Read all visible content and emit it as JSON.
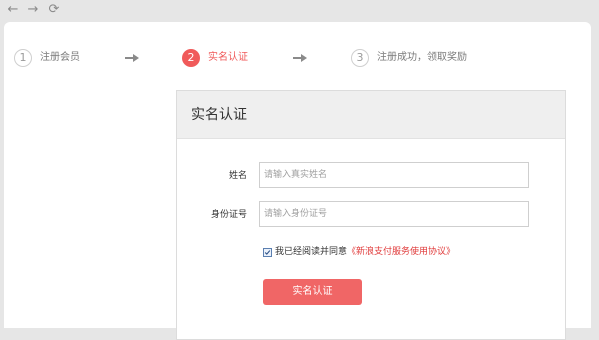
{
  "browser": {
    "back_icon": "arrow-left-icon",
    "forward_icon": "arrow-right-icon",
    "refresh_icon": "refresh-icon"
  },
  "steps": [
    {
      "number": "1",
      "label": "注册会员",
      "state": "inactive"
    },
    {
      "number": "2",
      "label": "实名认证",
      "state": "active"
    },
    {
      "number": "3",
      "label": "注册成功，领取奖励",
      "state": "inactive"
    }
  ],
  "card": {
    "title": "实名认证",
    "name_label": "姓名",
    "name_placeholder": "请输入真实姓名",
    "name_value": "",
    "id_label": "身份证号",
    "id_placeholder": "请输入身份证号",
    "id_value": "",
    "agree_checked": true,
    "agree_prefix": "我已经阅读并同意",
    "agree_link": "《新浪支付服务使用协议》",
    "submit_label": "实名认证"
  },
  "colors": {
    "accent": "#f05a5a",
    "button": "#f06666",
    "link": "#e03a3a"
  }
}
